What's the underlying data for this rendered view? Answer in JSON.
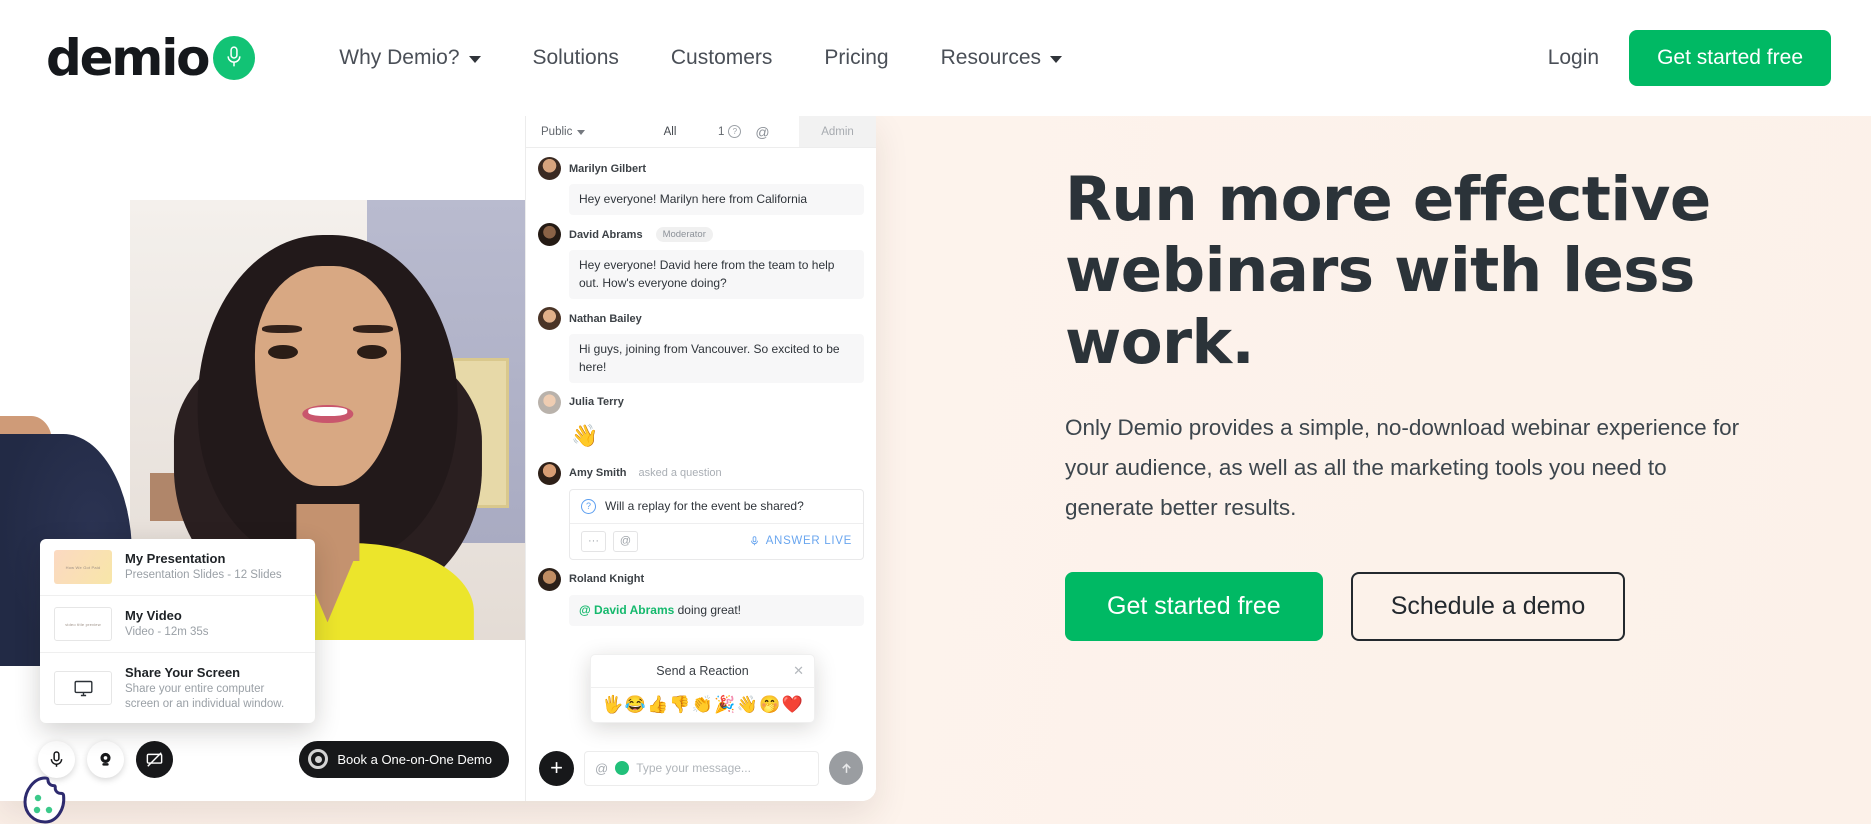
{
  "header": {
    "logo_text": "demio",
    "logo_icon": "microphone-icon",
    "nav": [
      {
        "label": "Why Demio?",
        "has_caret": true
      },
      {
        "label": "Solutions",
        "has_caret": false
      },
      {
        "label": "Customers",
        "has_caret": false
      },
      {
        "label": "Pricing",
        "has_caret": false
      },
      {
        "label": "Resources",
        "has_caret": true
      }
    ],
    "login_label": "Login",
    "cta_label": "Get started free"
  },
  "hero": {
    "title": "Run more effective webinars with less work.",
    "subtitle": "Only Demio provides a simple, no-download webinar experience for your audience, as well as all the marketing tools you need to generate better results.",
    "primary_cta": "Get started free",
    "secondary_cta": "Schedule a demo",
    "background_color": "#FCF1E9",
    "accent_color": "#00B964"
  },
  "app_mock": {
    "share_menu": [
      {
        "title": "My Presentation",
        "subtitle": "Presentation Slides - 12 Slides",
        "thumb": "slide-thumbnail"
      },
      {
        "title": "My Video",
        "subtitle": "Video - 12m 35s",
        "thumb": "video-thumbnail"
      },
      {
        "title": "Share Your Screen",
        "subtitle": "Share your entire computer screen or an individual window.",
        "thumb": "monitor-icon"
      }
    ],
    "toolbar": {
      "mic_icon": "microphone-icon",
      "camera_icon": "webcam-icon",
      "share_off_icon": "screen-share-off-icon",
      "book_demo_label": "Book a One-on-One Demo"
    }
  },
  "chat": {
    "tabs": {
      "visibility": "Public",
      "all": "All",
      "question_count": "1",
      "mention_icon": "at-icon",
      "admin": "Admin"
    },
    "messages": [
      {
        "name": "Marilyn Gilbert",
        "badge": "",
        "suffix": "",
        "text": "Hey everyone! Marilyn here from California",
        "type": "text"
      },
      {
        "name": "David Abrams",
        "badge": "Moderator",
        "suffix": "",
        "text": "Hey everyone! David here from the team to help out. How's everyone doing?",
        "type": "text"
      },
      {
        "name": "Nathan Bailey",
        "badge": "",
        "suffix": "",
        "text": "Hi guys, joining from Vancouver. So excited to be here!",
        "type": "text"
      },
      {
        "name": "Julia Terry",
        "badge": "",
        "suffix": "",
        "text": "👋",
        "type": "emoji"
      },
      {
        "name": "Amy Smith",
        "badge": "",
        "suffix": "asked a question",
        "text": "Will a replay for the event be shared?",
        "type": "question"
      },
      {
        "name": "Roland Knight",
        "badge": "",
        "suffix": "",
        "mention": "@ David Abrams",
        "text": " doing great!",
        "type": "mention"
      }
    ],
    "question_card": {
      "more_label": "···",
      "mention_label": "@",
      "answer_live_label": "ANSWER LIVE"
    },
    "reaction_popup": {
      "title": "Send a Reaction",
      "close_icon": "close-icon",
      "emojis": [
        "🖐️",
        "😂",
        "👍",
        "👎",
        "👏",
        "🎉",
        "👋",
        "🤭",
        "❤️"
      ]
    },
    "composer": {
      "plus_label": "+",
      "mention_icon": "at-icon",
      "emoji_icon": "emoji-icon",
      "placeholder": "Type your message...",
      "send_icon": "arrow-up-icon"
    }
  }
}
